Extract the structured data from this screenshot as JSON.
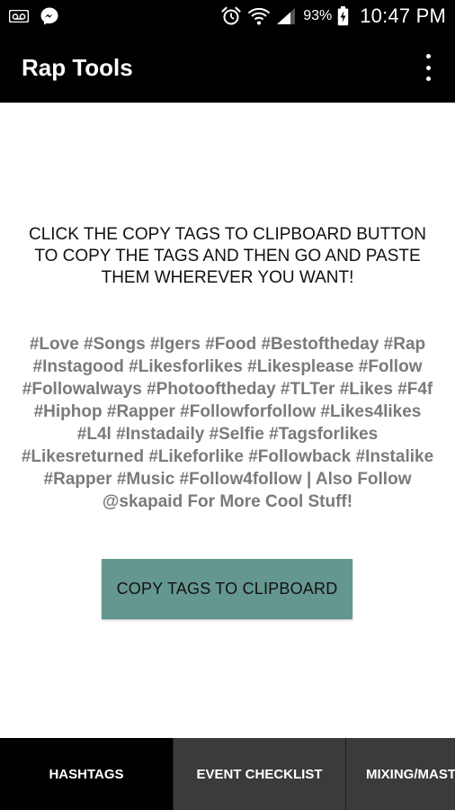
{
  "status_bar": {
    "icons_left": [
      "voicemail-icon",
      "messenger-icon"
    ],
    "icons_right": [
      "alarm-icon",
      "wifi-icon",
      "signal-icon",
      "battery-icon"
    ],
    "battery_percent": "93%",
    "time": "10:47 PM"
  },
  "app_bar": {
    "title": "Rap Tools",
    "menu_icon": "overflow-menu-icon"
  },
  "main": {
    "instructions": "CLICK THE COPY TAGS TO CLIPBOARD BUTTON TO COPY THE TAGS AND THEN GO AND PASTE THEM WHEREVER YOU WANT!",
    "tags": "#Love #Songs #Igers #Food #Bestoftheday #Rap #Instagood #Likesforlikes #Likesplease #Follow #Followalways #Photooftheday #TLTer #Likes #F4f #Hiphop #Rapper #Followforfollow #Likes4likes #L4l #Instadaily #Selfie #Tagsforlikes #Likesreturned #Likeforlike #Followback #Instalike #Rapper #Music #Follow4follow | Also Follow @skapaid For More Cool Stuff!",
    "copy_button_label": "COPY TAGS TO CLIPBOARD"
  },
  "tabs": [
    {
      "label": "HASHTAGS",
      "active": true
    },
    {
      "label": "EVENT CHECKLIST",
      "active": false
    },
    {
      "label": "MIXING/MAST",
      "active": false
    }
  ],
  "colors": {
    "app_bar": "#000000",
    "button": "#64978f",
    "tag_text": "#7a7a7a",
    "tab_active": "#000000",
    "tab_inactive": "#3b3b3b"
  }
}
